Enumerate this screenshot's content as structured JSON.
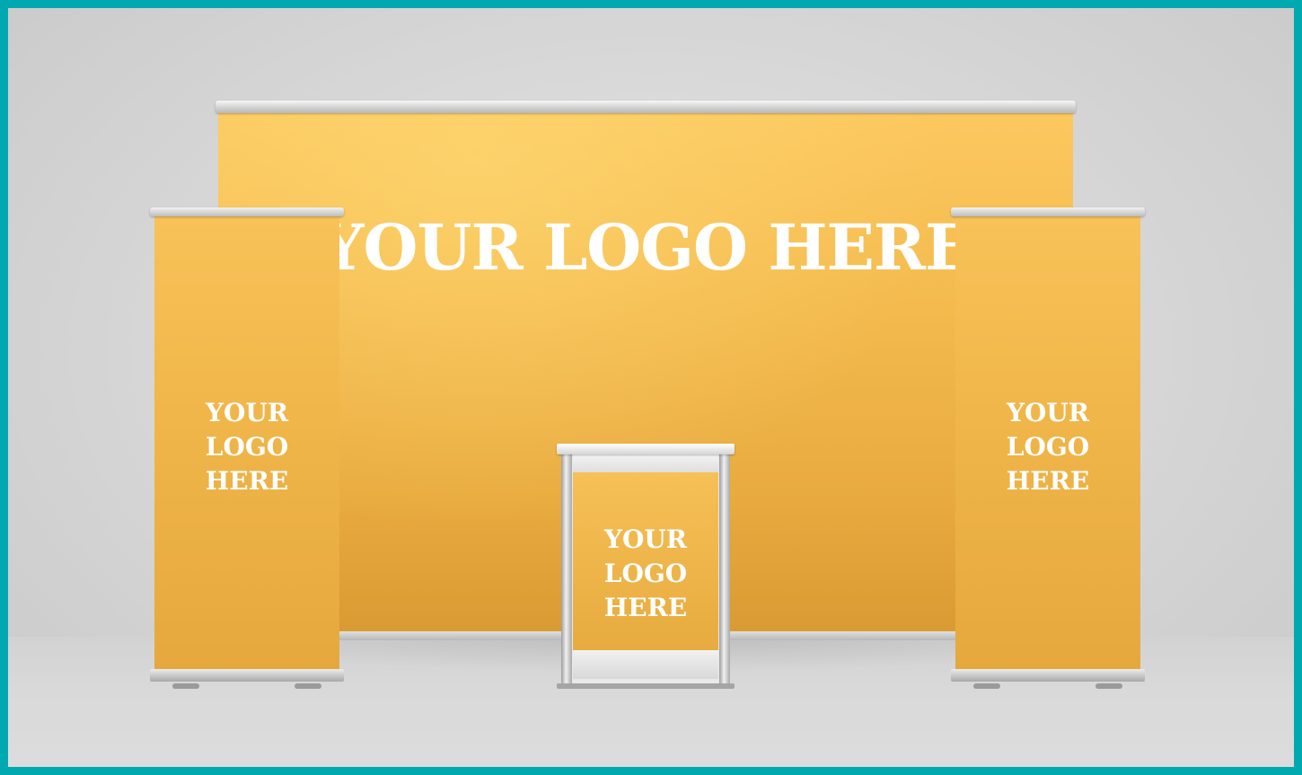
{
  "scene": {
    "frame_color": "#00a9b0",
    "banner_color": "#f4bb4f",
    "back_wall": {
      "logo_text": "YOUR LOGO HERE"
    },
    "left_banner": {
      "logo_lines": [
        "YOUR",
        "LOGO",
        "HERE"
      ]
    },
    "right_banner": {
      "logo_lines": [
        "YOUR",
        "LOGO",
        "HERE"
      ]
    },
    "counter": {
      "logo_lines": [
        "YOUR",
        "LOGO",
        "HERE"
      ]
    }
  }
}
